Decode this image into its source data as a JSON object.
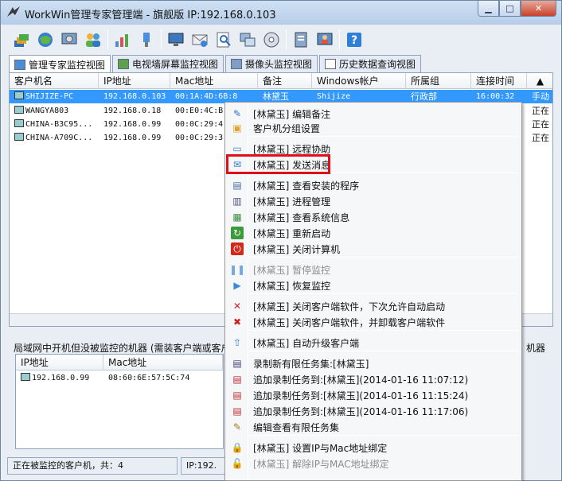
{
  "window": {
    "title": "WorkWin管理专家管理端 - 旗舰版 IP:192.168.0.103"
  },
  "tabs": [
    {
      "label": "管理专家监控视图"
    },
    {
      "label": "电视墙屏幕监控视图"
    },
    {
      "label": "摄像头监控视图"
    },
    {
      "label": "历史数据查询视图"
    }
  ],
  "table": {
    "columns": [
      "客户机名",
      "IP地址",
      "Mac地址",
      "备注",
      "Windows帐户",
      "所属组",
      "连接时间"
    ],
    "rows": [
      {
        "name": "SHIJIZE-PC",
        "ip": "192.168.0.103",
        "mac": "00:1A:4D:6B:8",
        "note": "林黛玉",
        "account": "Shijize",
        "group": "行政部",
        "time": "16:00:32",
        "extra": "手动"
      },
      {
        "name": "WANGYA803",
        "ip": "192.168.0.18",
        "mac": "00:E0:4C:B",
        "note": "",
        "account": "",
        "group": "",
        "time": "",
        "extra": "正在"
      },
      {
        "name": "CHINA-B3C95...",
        "ip": "192.168.0.99",
        "mac": "00:0C:29:4",
        "note": "",
        "account": "",
        "group": "",
        "time": "",
        "extra": "正在"
      },
      {
        "name": "CHINA-A709C...",
        "ip": "192.168.0.99",
        "mac": "00:0C:29:3",
        "note": "",
        "account": "",
        "group": "",
        "time": "",
        "extra": "正在"
      }
    ]
  },
  "lower": {
    "title": "局域网中开机但没被监控的机器 (需装客户端或客户",
    "title_right": "机器",
    "columns": [
      "IP地址",
      "Mac地址"
    ],
    "rows": [
      {
        "ip": "192.168.0.99",
        "mac": "08:60:6E:57:5C:74"
      }
    ]
  },
  "status": {
    "left": "正在被监控的客户机，共：4",
    "middle": "IP:192."
  },
  "context_menu": {
    "items": [
      {
        "label": "[林黛玉] 编辑备注",
        "icon": "pencil-icon",
        "disabled": false
      },
      {
        "label": "客户机分组设置",
        "icon": "group-icon",
        "disabled": false
      },
      {
        "label": "[林黛玉] 远程协助",
        "icon": "remote-assist-icon",
        "disabled": false
      },
      {
        "label": "[林黛玉] 发送消息",
        "icon": "send-message-icon",
        "disabled": false
      },
      {
        "label": "[林黛玉] 查看安装的程序",
        "icon": "installed-programs-icon",
        "disabled": false
      },
      {
        "label": "[林黛玉] 进程管理",
        "icon": "process-icon",
        "disabled": false
      },
      {
        "label": "[林黛玉] 查看系统信息",
        "icon": "system-info-icon",
        "disabled": false
      },
      {
        "label": "[林黛玉] 重新启动",
        "icon": "restart-icon",
        "disabled": false
      },
      {
        "label": "[林黛玉] 关闭计算机",
        "icon": "power-icon",
        "disabled": false
      },
      {
        "label": "[林黛玉] 暂停监控",
        "icon": "pause-icon",
        "disabled": true
      },
      {
        "label": "[林黛玉] 恢复监控",
        "icon": "play-icon",
        "disabled": false
      },
      {
        "label": "[林黛玉] 关闭客户端软件，下次允许自动启动",
        "icon": "close-x-icon",
        "disabled": false
      },
      {
        "label": "[林黛玉] 关闭客户端软件，并卸载客户端软件",
        "icon": "uninstall-icon",
        "disabled": false
      },
      {
        "label": "[林黛玉] 自动升级客户端",
        "icon": "upgrade-icon",
        "disabled": false
      },
      {
        "label": "录制新有限任务集:[林黛玉]",
        "icon": "record-icon",
        "disabled": false
      },
      {
        "label": "追加录制任务到:[林黛玉](2014-01-16 11:07:12)",
        "icon": "film-icon",
        "disabled": false
      },
      {
        "label": "追加录制任务到:[林黛玉](2014-01-16 11:15:24)",
        "icon": "film-icon",
        "disabled": false
      },
      {
        "label": "追加录制任务到:[林黛玉](2014-01-16 11:17:06)",
        "icon": "film-icon",
        "disabled": false
      },
      {
        "label": "编辑查看有限任务集",
        "icon": "edit-tasks-icon",
        "disabled": false
      },
      {
        "label": "[林黛玉] 设置IP与Mac地址绑定",
        "icon": "lock-icon",
        "disabled": false
      },
      {
        "label": "[林黛玉] 解除IP与MAC地址绑定",
        "icon": "unlock-icon",
        "disabled": true
      }
    ]
  },
  "colors": {
    "selection": "#3399ff",
    "highlight_box": "#e0101a",
    "title_bar": "#b7cde8"
  }
}
